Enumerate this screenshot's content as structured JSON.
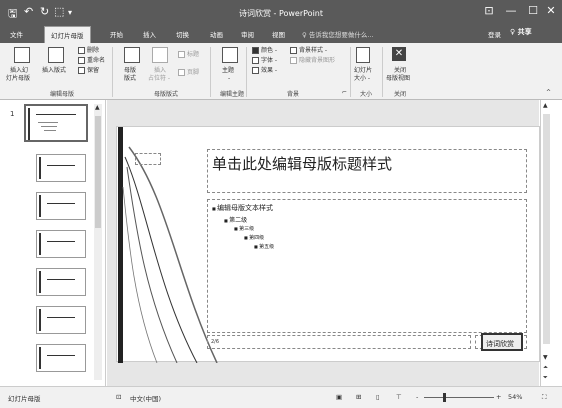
{
  "window": {
    "title": "诗词欣赏 - PowerPoint",
    "save_glyph": "🖫",
    "undo_glyph": "↶",
    "redo_glyph": "↻",
    "present_glyph": "⬚",
    "more_glyph": "▾",
    "ribbon_display_glyph": "⊡",
    "minimize_glyph": "—",
    "maximize_glyph": "☐",
    "close_glyph": "✕"
  },
  "tabs": {
    "file": "文件",
    "slide_master": "幻灯片母版",
    "home": "开始",
    "insert": "插入",
    "transitions": "切换",
    "animations": "动画",
    "review": "审阅",
    "view": "视图",
    "tell_me": "♀ 告诉我您想要做什么...",
    "sign_in": "登录",
    "share": "♀ 共享"
  },
  "ribbon": {
    "insert_master_line1": "插入幻",
    "insert_master_line2": "灯片母版",
    "insert_layout": "插入版式",
    "delete": "删除",
    "rename": "重命名",
    "preserve": "保留",
    "group_edit_master": "编辑母版",
    "master_layout_line1": "母版",
    "master_layout_line2": "版式",
    "insert_placeholder_line1": "插入",
    "insert_placeholder_line2": "占位符 -",
    "title_check": "标题",
    "footer_check": "页脚",
    "group_master_layout": "母版版式",
    "themes_line1": "主题",
    "themes_line2": "-",
    "group_edit_theme": "编辑主题",
    "colors": "颜色 -",
    "fonts": "字体 -",
    "effects": "效果 -",
    "bg_styles": "背景样式 -",
    "hide_bg": "隐藏背景图形",
    "group_background": "背景",
    "slide_size_line1": "幻灯片",
    "slide_size_line2": "大小 -",
    "group_size": "大小",
    "close_view_line1": "关闭",
    "close_view_line2": "母版视图",
    "group_close": "关闭",
    "dialog_launcher": "⌐",
    "collapse_glyph": "^"
  },
  "thumbnails": {
    "first_number": "1",
    "items": [
      {
        "kind": "master"
      },
      {
        "kind": "layout"
      },
      {
        "kind": "layout"
      },
      {
        "kind": "layout"
      },
      {
        "kind": "layout"
      },
      {
        "kind": "layout"
      },
      {
        "kind": "layout"
      }
    ]
  },
  "slide": {
    "title": "单击此处编辑母版标题样式",
    "bullets": [
      {
        "text": "编辑母版文本样式",
        "level": 1
      },
      {
        "text": "第二级",
        "level": 2
      },
      {
        "text": "第三级",
        "level": 3
      },
      {
        "text": "第四级",
        "level": 4
      },
      {
        "text": "第五级",
        "level": 5
      }
    ],
    "footer_date": "2/6",
    "footer_badge": "诗词欣赏"
  },
  "statusbar": {
    "view_name": "幻灯片母版",
    "language": "中文(中国)",
    "zoom": "54%",
    "zoom_minus": "-",
    "zoom_plus": "+",
    "zoom_level": 0.54
  },
  "colors": {
    "titlebar": "#5a5a5a",
    "ribbon": "#f1f1f1",
    "canvas": "#e6e6e6"
  }
}
